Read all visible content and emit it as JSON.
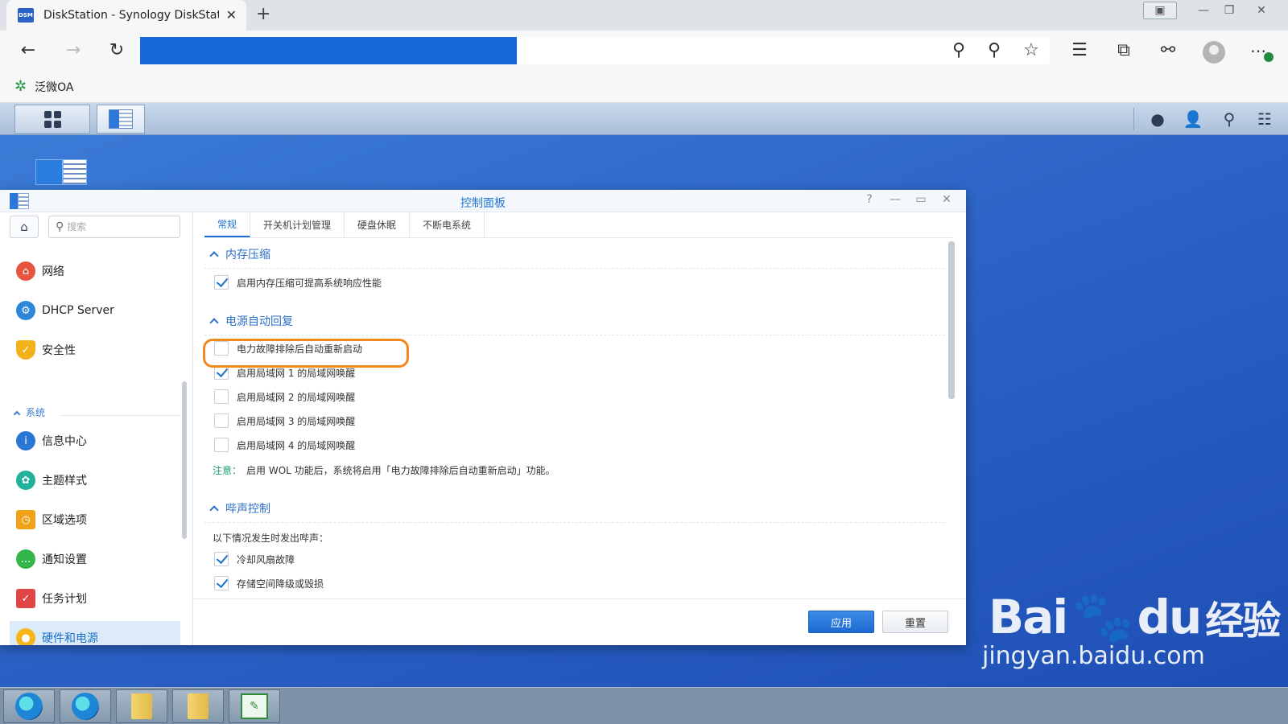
{
  "browser": {
    "tab_title": "DiskStation - Synology DiskStatio",
    "tab_favicon_text": "DSM",
    "tab_close": "✕",
    "new_tab": "+",
    "bookmark_label": "泛微OA"
  },
  "dsm": {
    "window_title": "控制面板"
  },
  "sidebar": {
    "search_placeholder": "搜索",
    "items": [
      {
        "label": "网络",
        "icon": "network-icon",
        "color": "#e8553e"
      },
      {
        "label": "DHCP Server",
        "icon": "dhcp-icon",
        "color": "#2e86d8"
      },
      {
        "label": "安全性",
        "icon": "shield-icon",
        "color": "#f3b21c"
      }
    ],
    "section": "系统",
    "system_items": [
      {
        "label": "信息中心",
        "icon": "info-icon",
        "color": "#2a76d4"
      },
      {
        "label": "主题样式",
        "icon": "palette-icon",
        "color": "#20b29a"
      },
      {
        "label": "区域选项",
        "icon": "region-icon",
        "color": "#f0a21a"
      },
      {
        "label": "通知设置",
        "icon": "chat-icon",
        "color": "#33b54a"
      },
      {
        "label": "任务计划",
        "icon": "calendar-icon",
        "color": "#e04545"
      },
      {
        "label": "硬件和电源",
        "icon": "bulb-icon",
        "color": "#f6b51c"
      }
    ]
  },
  "tabs": [
    "常规",
    "开关机计划管理",
    "硬盘休眠",
    "不断电系统"
  ],
  "sections": {
    "memory": {
      "title": "内存压缩",
      "option": "启用内存压缩可提高系统响应性能"
    },
    "power": {
      "title": "电源自动回复",
      "options": [
        {
          "label": "电力故障排除后自动重新启动",
          "checked": false
        },
        {
          "label": "启用局域网 1 的局域网唤醒",
          "checked": true
        },
        {
          "label": "启用局域网 2 的局域网唤醒",
          "checked": false
        },
        {
          "label": "启用局域网 3 的局域网唤醒",
          "checked": false
        },
        {
          "label": "启用局域网 4 的局域网唤醒",
          "checked": false
        }
      ],
      "note_label": "注意：",
      "note_text": "启用 WOL 功能后，系统将启用「电力故障排除后自动重新启动」功能。"
    },
    "beep": {
      "title": "哔声控制",
      "intro": "以下情况发生时发出哔声：",
      "options": [
        {
          "label": "冷却风扇故障",
          "checked": true
        },
        {
          "label": "存储空间降级或毁损",
          "checked": true
        }
      ]
    }
  },
  "footer": {
    "apply": "应用",
    "reset": "重置"
  },
  "watermark": {
    "logo": "Bai",
    "logo2": "du",
    "cn": "经验",
    "url": "jingyan.baidu.com"
  }
}
